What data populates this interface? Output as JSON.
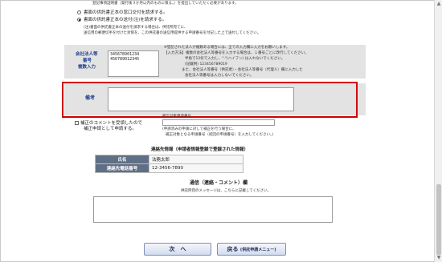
{
  "top_note": "登記事項証明書（発行後３か月以内のものに限る。）を提出していただく必要があります。",
  "radio_window": "書面の供託書正本の窓口交付を請求する。",
  "radio_mail": "書面の供託書正本の送付(注)を請求する。",
  "mail_note_1": "(注)書面の供託書正本の送付を請求する場合は、供託所宛てに、",
  "mail_note_2": "送信用の郵便切手を付けた封筒を、この供託書の送信用提供する申請番号を付記した上で送付してください。",
  "corp": {
    "label_1": "会社法人等",
    "label_2": "番号",
    "label_3": "複数入力",
    "value_1": "345678901234",
    "value_2": "456789012345",
    "note_1": "※登記された法人が複数ある場合には、全ての入力欄に入力をお願いします。",
    "note_2": "【入力方法】複数の会社法人等番号を入力する場合は、１番号ごとに改行してください。",
    "note_3": "半角で12桁で入力し、\"-\"(ハイフン) は入れないでください。",
    "note_4": "(記載例) 123456789019",
    "note_5": "また、会社法人等番号（供託者）・会社法人等番号（代理人）欄に入力した",
    "note_6": "会社法人等番号は入力しないでください。"
  },
  "remarks": {
    "label": "備考",
    "value": ""
  },
  "correction": {
    "checkbox_label_1": "補正のコメントを受領したので",
    "checkbox_label_2": "補正申請として申請する。",
    "field_label": "補正対象申請番号",
    "note_1": "(申請済みの申請に対して補正を行う場合に、",
    "note_2": "補正対象となる申請番号（初回の申請番号）を入力してください。)"
  },
  "contact": {
    "title": "連絡先情報（申請者情報登録で登録された情報）",
    "name_label": "氏名",
    "name_value": "法務太郎",
    "phone_label": "連絡先電話番号",
    "phone_value": "12-3456-7890"
  },
  "message": {
    "title": "通信（連絡・コメント）欄",
    "subtitle": "供託所宛のメッセージは、こちらに記載してください。",
    "value": ""
  },
  "buttons": {
    "next": "次　へ",
    "back": "戻る",
    "back_sub": "(供託申請メニュー)"
  }
}
